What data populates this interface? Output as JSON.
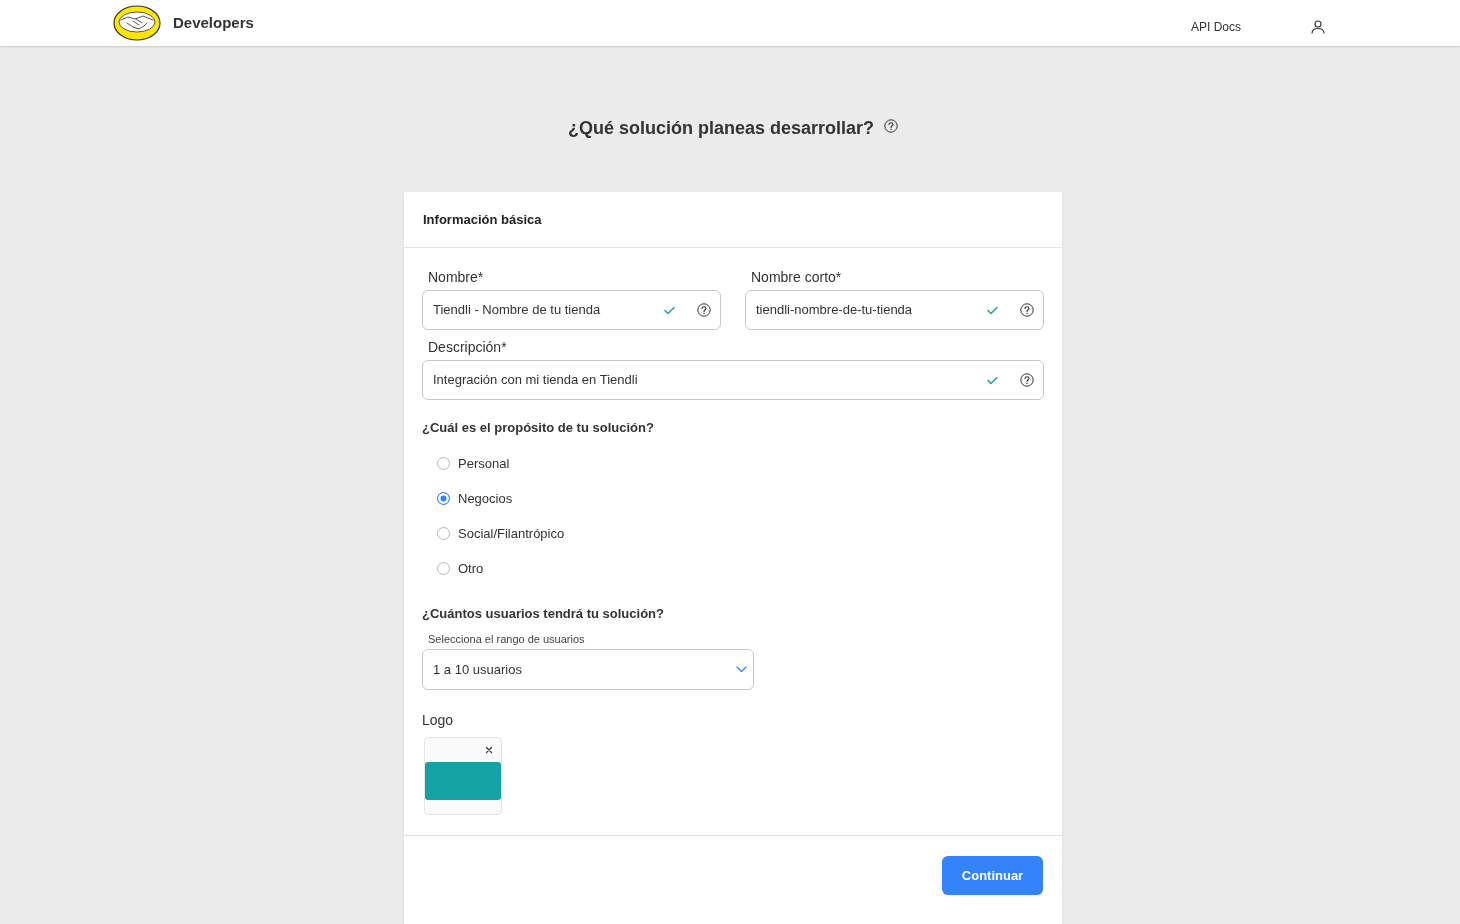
{
  "header": {
    "brand": "Developers",
    "links": [
      "API Docs"
    ]
  },
  "title": "¿Qué solución planeas desarrollar?",
  "form": {
    "section_title": "Información básica",
    "field_rows": [
      [
        {
          "label": "Nombre*",
          "value": "Tiendli - Nombre de tu tienda",
          "valid": true
        },
        {
          "label": "Nombre corto*",
          "value": "tiendli-nombre-de-tu-tienda",
          "valid": true
        }
      ],
      [
        {
          "label": "Descripción*",
          "value": "Integración con mi tienda en Tiendli",
          "valid": true
        }
      ]
    ],
    "purpose": {
      "question": "¿Cuál es el propósito de tu solución?",
      "options": [
        {
          "label": "Personal",
          "selected": false
        },
        {
          "label": "Negocios",
          "selected": true
        },
        {
          "label": "Social/Filantrópico",
          "selected": false
        },
        {
          "label": "Otro",
          "selected": false
        }
      ]
    },
    "users": {
      "question": "¿Cuántos usuarios tendrá tu solución?",
      "select": {
        "label": "Selecciona el rango de usuarios",
        "value": "1 a 10 usuarios"
      }
    },
    "logo": {
      "label": "Logo"
    },
    "submit": "Continuar"
  }
}
